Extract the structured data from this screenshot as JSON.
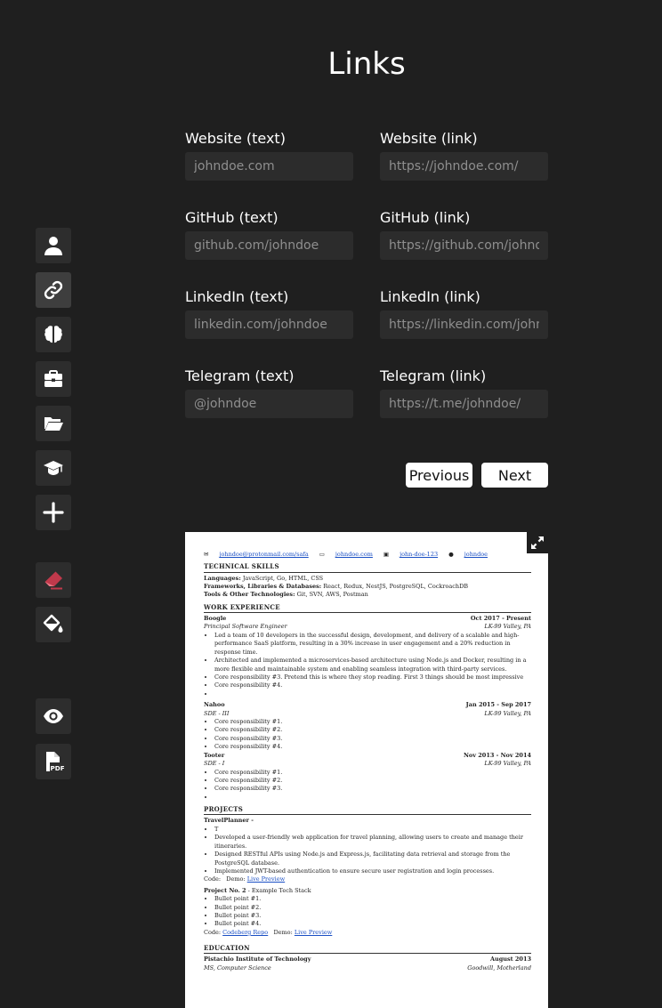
{
  "page": {
    "title": "Links"
  },
  "sidebar": {
    "items": [
      {
        "name": "personal-info",
        "icon": "person-icon"
      },
      {
        "name": "links",
        "icon": "link-icon",
        "active": true
      },
      {
        "name": "skills",
        "icon": "brain-icon"
      },
      {
        "name": "experience",
        "icon": "briefcase-icon"
      },
      {
        "name": "projects",
        "icon": "folder-open-icon"
      },
      {
        "name": "education",
        "icon": "graduation-cap-icon"
      },
      {
        "name": "add-section",
        "icon": "plus-icon"
      },
      {
        "name": "clear",
        "icon": "eraser-icon"
      },
      {
        "name": "theme",
        "icon": "paint-bucket-icon"
      },
      {
        "name": "preview",
        "icon": "eye-icon"
      },
      {
        "name": "export-pdf",
        "icon": "pdf-file-icon"
      }
    ]
  },
  "form": {
    "fields": [
      {
        "label": "Website (text)",
        "placeholder": "johndoe.com",
        "value": ""
      },
      {
        "label": "Website (link)",
        "placeholder": "https://johndoe.com/",
        "value": ""
      },
      {
        "label": "GitHub (text)",
        "placeholder": "github.com/johndoe",
        "value": ""
      },
      {
        "label": "GitHub (link)",
        "placeholder": "https://github.com/johndoe",
        "value": ""
      },
      {
        "label": "LinkedIn (text)",
        "placeholder": "linkedin.com/johndoe",
        "value": ""
      },
      {
        "label": "LinkedIn (link)",
        "placeholder": "https://linkedin.com/johndoe",
        "value": ""
      },
      {
        "label": "Telegram (text)",
        "placeholder": "@johndoe",
        "value": ""
      },
      {
        "label": "Telegram (link)",
        "placeholder": "https://t.me/johndoe/",
        "value": ""
      }
    ],
    "prev_label": "Previous",
    "next_label": "Next"
  },
  "colors": {
    "background": "#1f1f1f",
    "input_bg": "#2c2c2c",
    "button_bg": "#2d2d2d",
    "eraser": "#c0394b"
  },
  "resume": {
    "contacts": [
      "johndoe@protonmail.com/safa",
      "johndoe.com",
      "john-doe-123",
      "johndoe"
    ],
    "skills_title": "TECHNICAL SKILLS",
    "skills": [
      {
        "k": "Languages:",
        "v": "JavaScript, Go, HTML, CSS"
      },
      {
        "k": "Frameworks, Libraries & Databases:",
        "v": "React, Redux, NestJS, PostgreSQL, CockroachDB"
      },
      {
        "k": "Tools & Other Technologies:",
        "v": "Git, SVN, AWS, Postman"
      }
    ],
    "experience_title": "WORK EXPERIENCE",
    "jobs": [
      {
        "company": "Boogle",
        "dates": "Oct 2017 - Present",
        "role": "Principal Software Engineer",
        "location": "LK-99 Valley, PA",
        "bullets": [
          "Led a team of 10 developers in the successful design, development, and delivery of a scalable and high-performance SaaS platform, resulting in a 30% increase in user engagement and a 20% reduction in response time.",
          "Architected and implemented a microservices-based architecture using Node.js and Docker, resulting in a more flexible and maintainable system and enabling seamless integration with third-party services.",
          "Core responsibility #3. Pretend this is where they stop reading. First 3 things should be most impressive",
          "Core responsibility #4.",
          ""
        ]
      },
      {
        "company": "Nahoo",
        "dates": "Jan 2015 - Sep 2017",
        "role": "SDE - III",
        "location": "LK-99 Valley, PA",
        "bullets": [
          "Core responsibility #1.",
          "Core responsibility #2.",
          "Core responsibility #3.",
          "Core responsibility #4."
        ]
      },
      {
        "company": "Tooter",
        "dates": "Nov 2013 - Nov 2014",
        "role": "SDE - I",
        "location": "LK-99 Valley, PA",
        "bullets": [
          "Core responsibility #1.",
          "Core responsibility #2.",
          "Core responsibility #3.",
          ""
        ]
      }
    ],
    "projects_title": "PROJECTS",
    "project1": {
      "name": "TravelPlanner -",
      "bullets": [
        "T",
        "Developed a user-friendly web application for travel planning, allowing users to create and manage their itineraries.",
        "Designed RESTful APIs using Node.js and Express.js, facilitating data retrieval and storage from the PostgreSQL database.",
        "Implemented JWT-based authentication to ensure secure user registration and login processes."
      ],
      "code_label": "Code:",
      "demo_label": "Demo:",
      "demo_link": "Live Preview"
    },
    "project2": {
      "name": "Project No. 2",
      "stack": "- Example Tech Stack",
      "bullets": [
        "Bullet point #1.",
        "Bullet point #2.",
        "Bullet point #3.",
        "Bullet point #4."
      ],
      "code_label": "Code:",
      "code_link": "Codeberg Repo",
      "demo_label": "Demo:",
      "demo_link": "Live Preview"
    },
    "education_title": "EDUCATION",
    "school": {
      "name": "Pistachio Institute of Technology",
      "date": "August 2013",
      "degree": "MS, Computer Science",
      "location": "Goodwill, Motherland"
    }
  }
}
